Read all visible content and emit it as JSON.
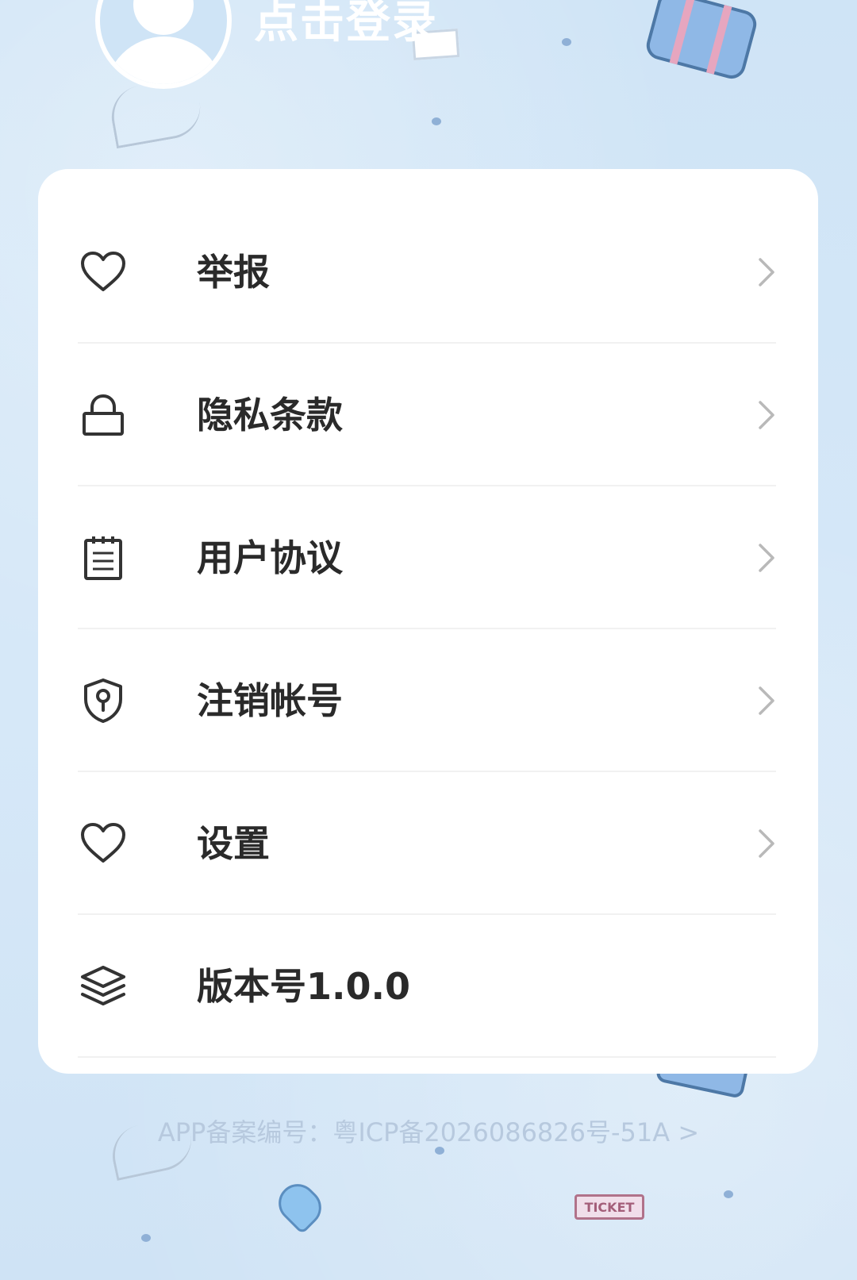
{
  "header": {
    "login_label": "点击登录"
  },
  "menu": {
    "items": [
      {
        "label": "举报",
        "icon": "heart-icon",
        "has_chevron": true
      },
      {
        "label": "隐私条款",
        "icon": "lock-icon",
        "has_chevron": true
      },
      {
        "label": "用户协议",
        "icon": "notepad-icon",
        "has_chevron": true
      },
      {
        "label": "注销帐号",
        "icon": "shield-keyhole-icon",
        "has_chevron": true
      },
      {
        "label": "设置",
        "icon": "heart-icon",
        "has_chevron": true
      },
      {
        "label": "版本号1.0.0",
        "icon": "layers-icon",
        "has_chevron": false
      }
    ]
  },
  "footer": {
    "icp_text": "APP备案编号：粤ICP备2026086826号-51A >"
  },
  "decorations": {
    "ticket_text": "TICKET"
  },
  "colors": {
    "background": "#cfe4f6",
    "card": "#ffffff",
    "text": "#2a2a2a",
    "icp_text": "#b7c9de",
    "chevron": "#b9b9b9",
    "icon_stroke": "#333333"
  }
}
